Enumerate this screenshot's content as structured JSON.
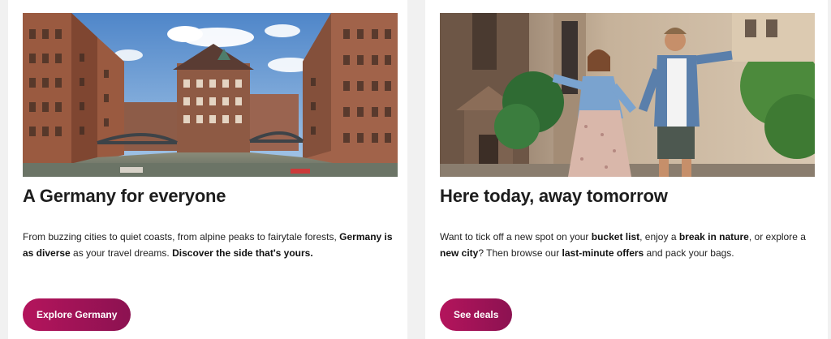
{
  "cards": [
    {
      "title": "A Germany for everyone",
      "image_alt": "Hamburg Speicherstadt canal with red-brick warehouses and bridges",
      "body": [
        {
          "text": "From buzzing cities to quiet coasts, from alpine peaks to fairytale forests, ",
          "bold": false
        },
        {
          "text": "Germany is as diverse",
          "bold": true
        },
        {
          "text": " as your travel dreams. ",
          "bold": false
        },
        {
          "text": "Discover the side that's yours.",
          "bold": true
        }
      ],
      "button_label": "Explore Germany"
    },
    {
      "title": "Here today, away tomorrow",
      "image_alt": "Smiling couple running hand in hand through a city square",
      "body": [
        {
          "text": "Want to tick off a new spot on your ",
          "bold": false
        },
        {
          "text": "bucket list",
          "bold": true
        },
        {
          "text": ", enjoy a ",
          "bold": false
        },
        {
          "text": "break in nature",
          "bold": true
        },
        {
          "text": ", or explore a ",
          "bold": false
        },
        {
          "text": "new city",
          "bold": true
        },
        {
          "text": "? Then browse our ",
          "bold": false
        },
        {
          "text": "last-minute offers",
          "bold": true
        },
        {
          "text": " and pack your bags.",
          "bold": false
        }
      ],
      "button_label": "See deals"
    }
  ],
  "colors": {
    "button_start": "#b4145c",
    "button_end": "#8c1251",
    "title": "#1d1d1d",
    "card_bg": "#ffffff",
    "page_bg": "#f1f1f1"
  }
}
